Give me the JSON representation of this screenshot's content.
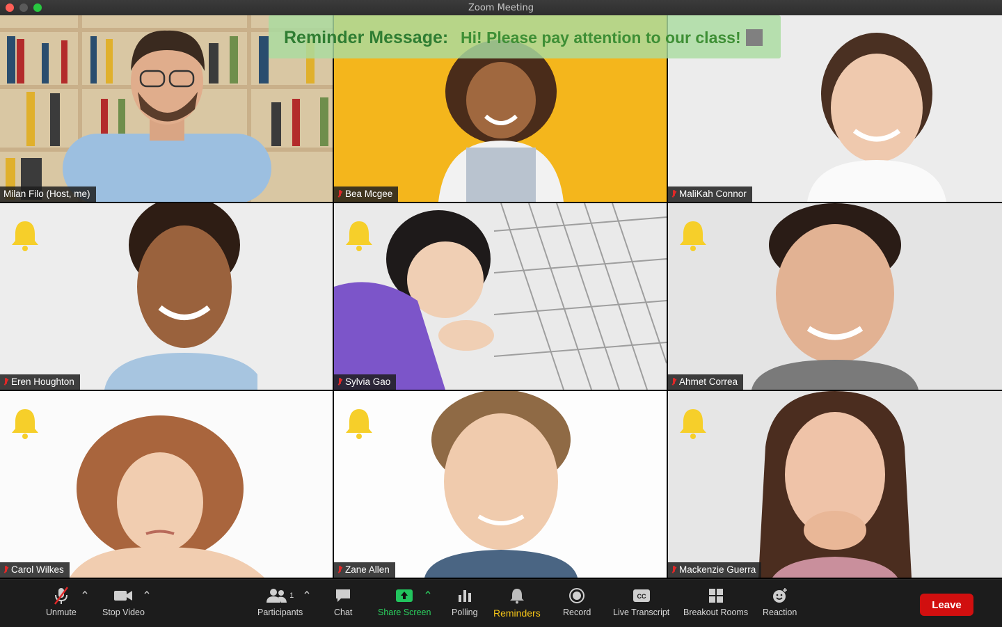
{
  "window": {
    "title": "Zoom Meeting"
  },
  "reminder": {
    "label": "Reminder Message:",
    "message": "Hi! Please pay attention to our class!"
  },
  "participants": [
    {
      "name": "Milan Filo (Host, me)",
      "muted": false,
      "bell": false
    },
    {
      "name": "Bea Mcgee",
      "muted": true,
      "bell": false
    },
    {
      "name": "MaliKah Connor",
      "muted": true,
      "bell": false
    },
    {
      "name": "Eren Houghton",
      "muted": true,
      "bell": true
    },
    {
      "name": "Sylvia Gao",
      "muted": true,
      "bell": true
    },
    {
      "name": "Ahmet Correa",
      "muted": true,
      "bell": true
    },
    {
      "name": "Carol Wilkes",
      "muted": true,
      "bell": true
    },
    {
      "name": "Zane Allen",
      "muted": true,
      "bell": true
    },
    {
      "name": "Mackenzie Guerra",
      "muted": true,
      "bell": true
    }
  ],
  "toolbar": {
    "unmute": "Unmute",
    "stop_video": "Stop Video",
    "participants": "Participants",
    "participants_count": "1",
    "chat": "Chat",
    "share_screen": "Share Screen",
    "polling": "Polling",
    "reminders": "Reminders",
    "record": "Record",
    "live_transcript": "Live Transcript",
    "breakout_rooms": "Breakout Rooms",
    "reaction": "Reaction",
    "leave": "Leave"
  },
  "colors": {
    "accent_green": "#2f7d32",
    "share_green": "#22c55e",
    "reminders_yellow": "#f5c518",
    "leave_red": "#d10f0f",
    "bell_yellow": "#f6cf2a"
  }
}
